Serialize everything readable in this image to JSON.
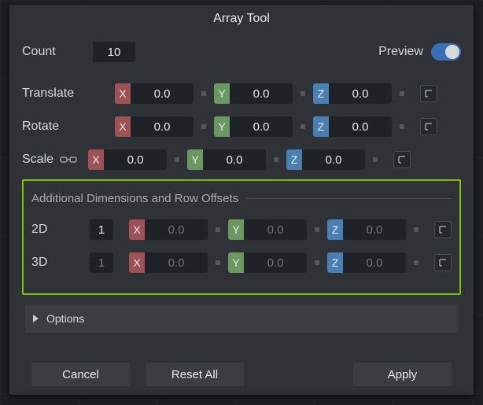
{
  "title": "Array Tool",
  "fields": {
    "count_label": "Count",
    "preview_label": "Preview",
    "translate_label": "Translate",
    "rotate_label": "Rotate",
    "scale_label": "Scale",
    "options_label": "Options"
  },
  "values": {
    "count": "10",
    "preview_on": true,
    "translate": {
      "x": "0.0",
      "y": "0.0",
      "z": "0.0"
    },
    "rotate": {
      "x": "0.0",
      "y": "0.0",
      "z": "0.0"
    },
    "scale": {
      "x": "0.0",
      "y": "0.0",
      "z": "0.0"
    }
  },
  "group": {
    "title": "Additional Dimensions and Row Offsets",
    "rows": {
      "d2": {
        "label": "2D",
        "count": "1",
        "x": "0.0",
        "y": "0.0",
        "z": "0.0",
        "enabled": true
      },
      "d3": {
        "label": "3D",
        "count": "1",
        "x": "0.0",
        "y": "0.0",
        "z": "0.0",
        "enabled": false
      }
    }
  },
  "axis": {
    "x": "X",
    "y": "Y",
    "z": "Z"
  },
  "buttons": {
    "cancel": "Cancel",
    "reset": "Reset All",
    "apply": "Apply"
  },
  "icons": {
    "link": "link-icon",
    "transform": "transform-icon"
  }
}
